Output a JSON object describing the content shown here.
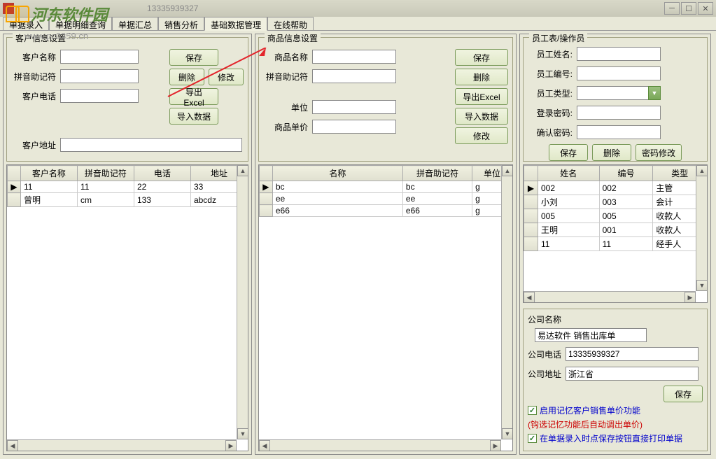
{
  "titlebar": {
    "text": "13335939327"
  },
  "logo": {
    "text": "河东软件园"
  },
  "watermark": "www.pc0359.cn",
  "tabs": [
    "单据录入",
    "单据明细查询",
    "单据汇总",
    "销售分析",
    "基础数据管理",
    "在线帮助"
  ],
  "activeTab": 4,
  "customer": {
    "title": "客户信息设置",
    "labels": {
      "name": "客户名称",
      "pinyin": "拼音助记符",
      "phone": "客户电话",
      "address": "客户地址"
    },
    "buttons": {
      "save": "保存",
      "delete": "删除",
      "modify": "修改",
      "exportExcel": "导出Excel",
      "importData": "导入数据"
    },
    "columns": [
      "客户名称",
      "拼音助记符",
      "电话",
      "地址"
    ],
    "rows": [
      {
        "name": "11",
        "pinyin": "11",
        "phone": "22",
        "address": "33"
      },
      {
        "name": "曾明",
        "pinyin": "cm",
        "phone": "133",
        "address": "abcdz"
      }
    ]
  },
  "product": {
    "title": "商品信息设置",
    "labels": {
      "name": "商品名称",
      "pinyin": "拼音助记符",
      "unit": "单位",
      "price": "商品单价"
    },
    "buttons": {
      "save": "保存",
      "delete": "删除",
      "exportExcel": "导出Excel",
      "importData": "导入数据",
      "modify": "修改"
    },
    "columns": [
      "名称",
      "拼音助记符",
      "单位"
    ],
    "rows": [
      {
        "name": "bc",
        "pinyin": "bc",
        "unit": "g"
      },
      {
        "name": "ee",
        "pinyin": "ee",
        "unit": "g"
      },
      {
        "name": "e66",
        "pinyin": "e66",
        "unit": "g"
      }
    ]
  },
  "employee": {
    "title": "员工表/操作员",
    "labels": {
      "name": "员工姓名:",
      "id": "员工编号:",
      "type": "员工类型:",
      "pwd": "登录密码:",
      "pwd2": "确认密码:"
    },
    "buttons": {
      "save": "保存",
      "delete": "删除",
      "changePwd": "密码修改"
    },
    "columns": [
      "姓名",
      "编号",
      "类型"
    ],
    "rows": [
      {
        "name": "002",
        "id": "002",
        "type": "主管"
      },
      {
        "name": "小刘",
        "id": "003",
        "type": "会计"
      },
      {
        "name": "005",
        "id": "005",
        "type": "收款人"
      },
      {
        "name": "王明",
        "id": "001",
        "type": "收款人"
      },
      {
        "name": "11",
        "id": "11",
        "type": "经手人"
      }
    ]
  },
  "company": {
    "title": "公司名称",
    "name": "易达软件 销售出库单",
    "labels": {
      "phone": "公司电话",
      "address": "公司地址"
    },
    "phone": "13335939327",
    "address": "浙江省",
    "saveBtn": "保存"
  },
  "options": {
    "opt1": "启用记忆客户销售单价功能",
    "note": "(钩选记忆功能后自动调出单价)",
    "opt2": "在单据录入时点保存按钮直接打印单据"
  }
}
